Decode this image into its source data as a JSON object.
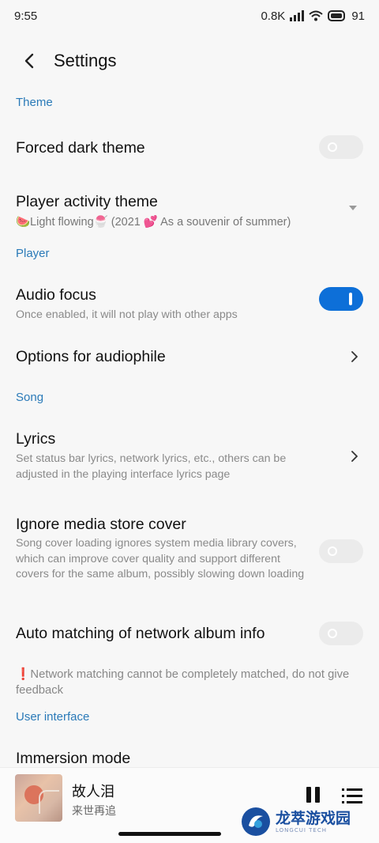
{
  "status_bar": {
    "time": "9:55",
    "net_speed": "0.8K",
    "net_unit": "KB/s",
    "battery_level": "91"
  },
  "header": {
    "title": "Settings"
  },
  "sections": {
    "theme": "Theme",
    "player": "Player",
    "song": "Song",
    "ui": "User interface"
  },
  "settings": {
    "forced_dark": {
      "title": "Forced dark theme",
      "enabled": false
    },
    "player_activity_theme": {
      "title": "Player activity theme",
      "value": "🍉Light flowing🍧 (2021 💕 As a souvenir of summer)"
    },
    "audio_focus": {
      "title": "Audio focus",
      "subtitle": "Once enabled, it will not play with other apps",
      "enabled": true
    },
    "audiophile": {
      "title": "Options for audiophile"
    },
    "lyrics": {
      "title": "Lyrics",
      "subtitle": "Set status bar lyrics, network lyrics, etc., others can be adjusted in the playing interface lyrics page"
    },
    "ignore_cover": {
      "title": "Ignore media store cover",
      "subtitle": "Song cover loading ignores system media library covers, which can improve cover quality and support different covers for the same album, possibly slowing down loading",
      "enabled": false
    },
    "auto_match": {
      "title": "Auto matching of network album info",
      "enabled": false,
      "note": "❗Network matching cannot be completely matched, do not give feedback"
    },
    "immersion": {
      "title": "Immersion mode"
    }
  },
  "player": {
    "song_title": "故人泪",
    "artist": "来世再追"
  },
  "watermark": {
    "name": "龙萃游戏园",
    "sub": "LONGCUI TECH"
  },
  "colors": {
    "accent": "#0d6fd8",
    "section": "#2a7ab8"
  }
}
